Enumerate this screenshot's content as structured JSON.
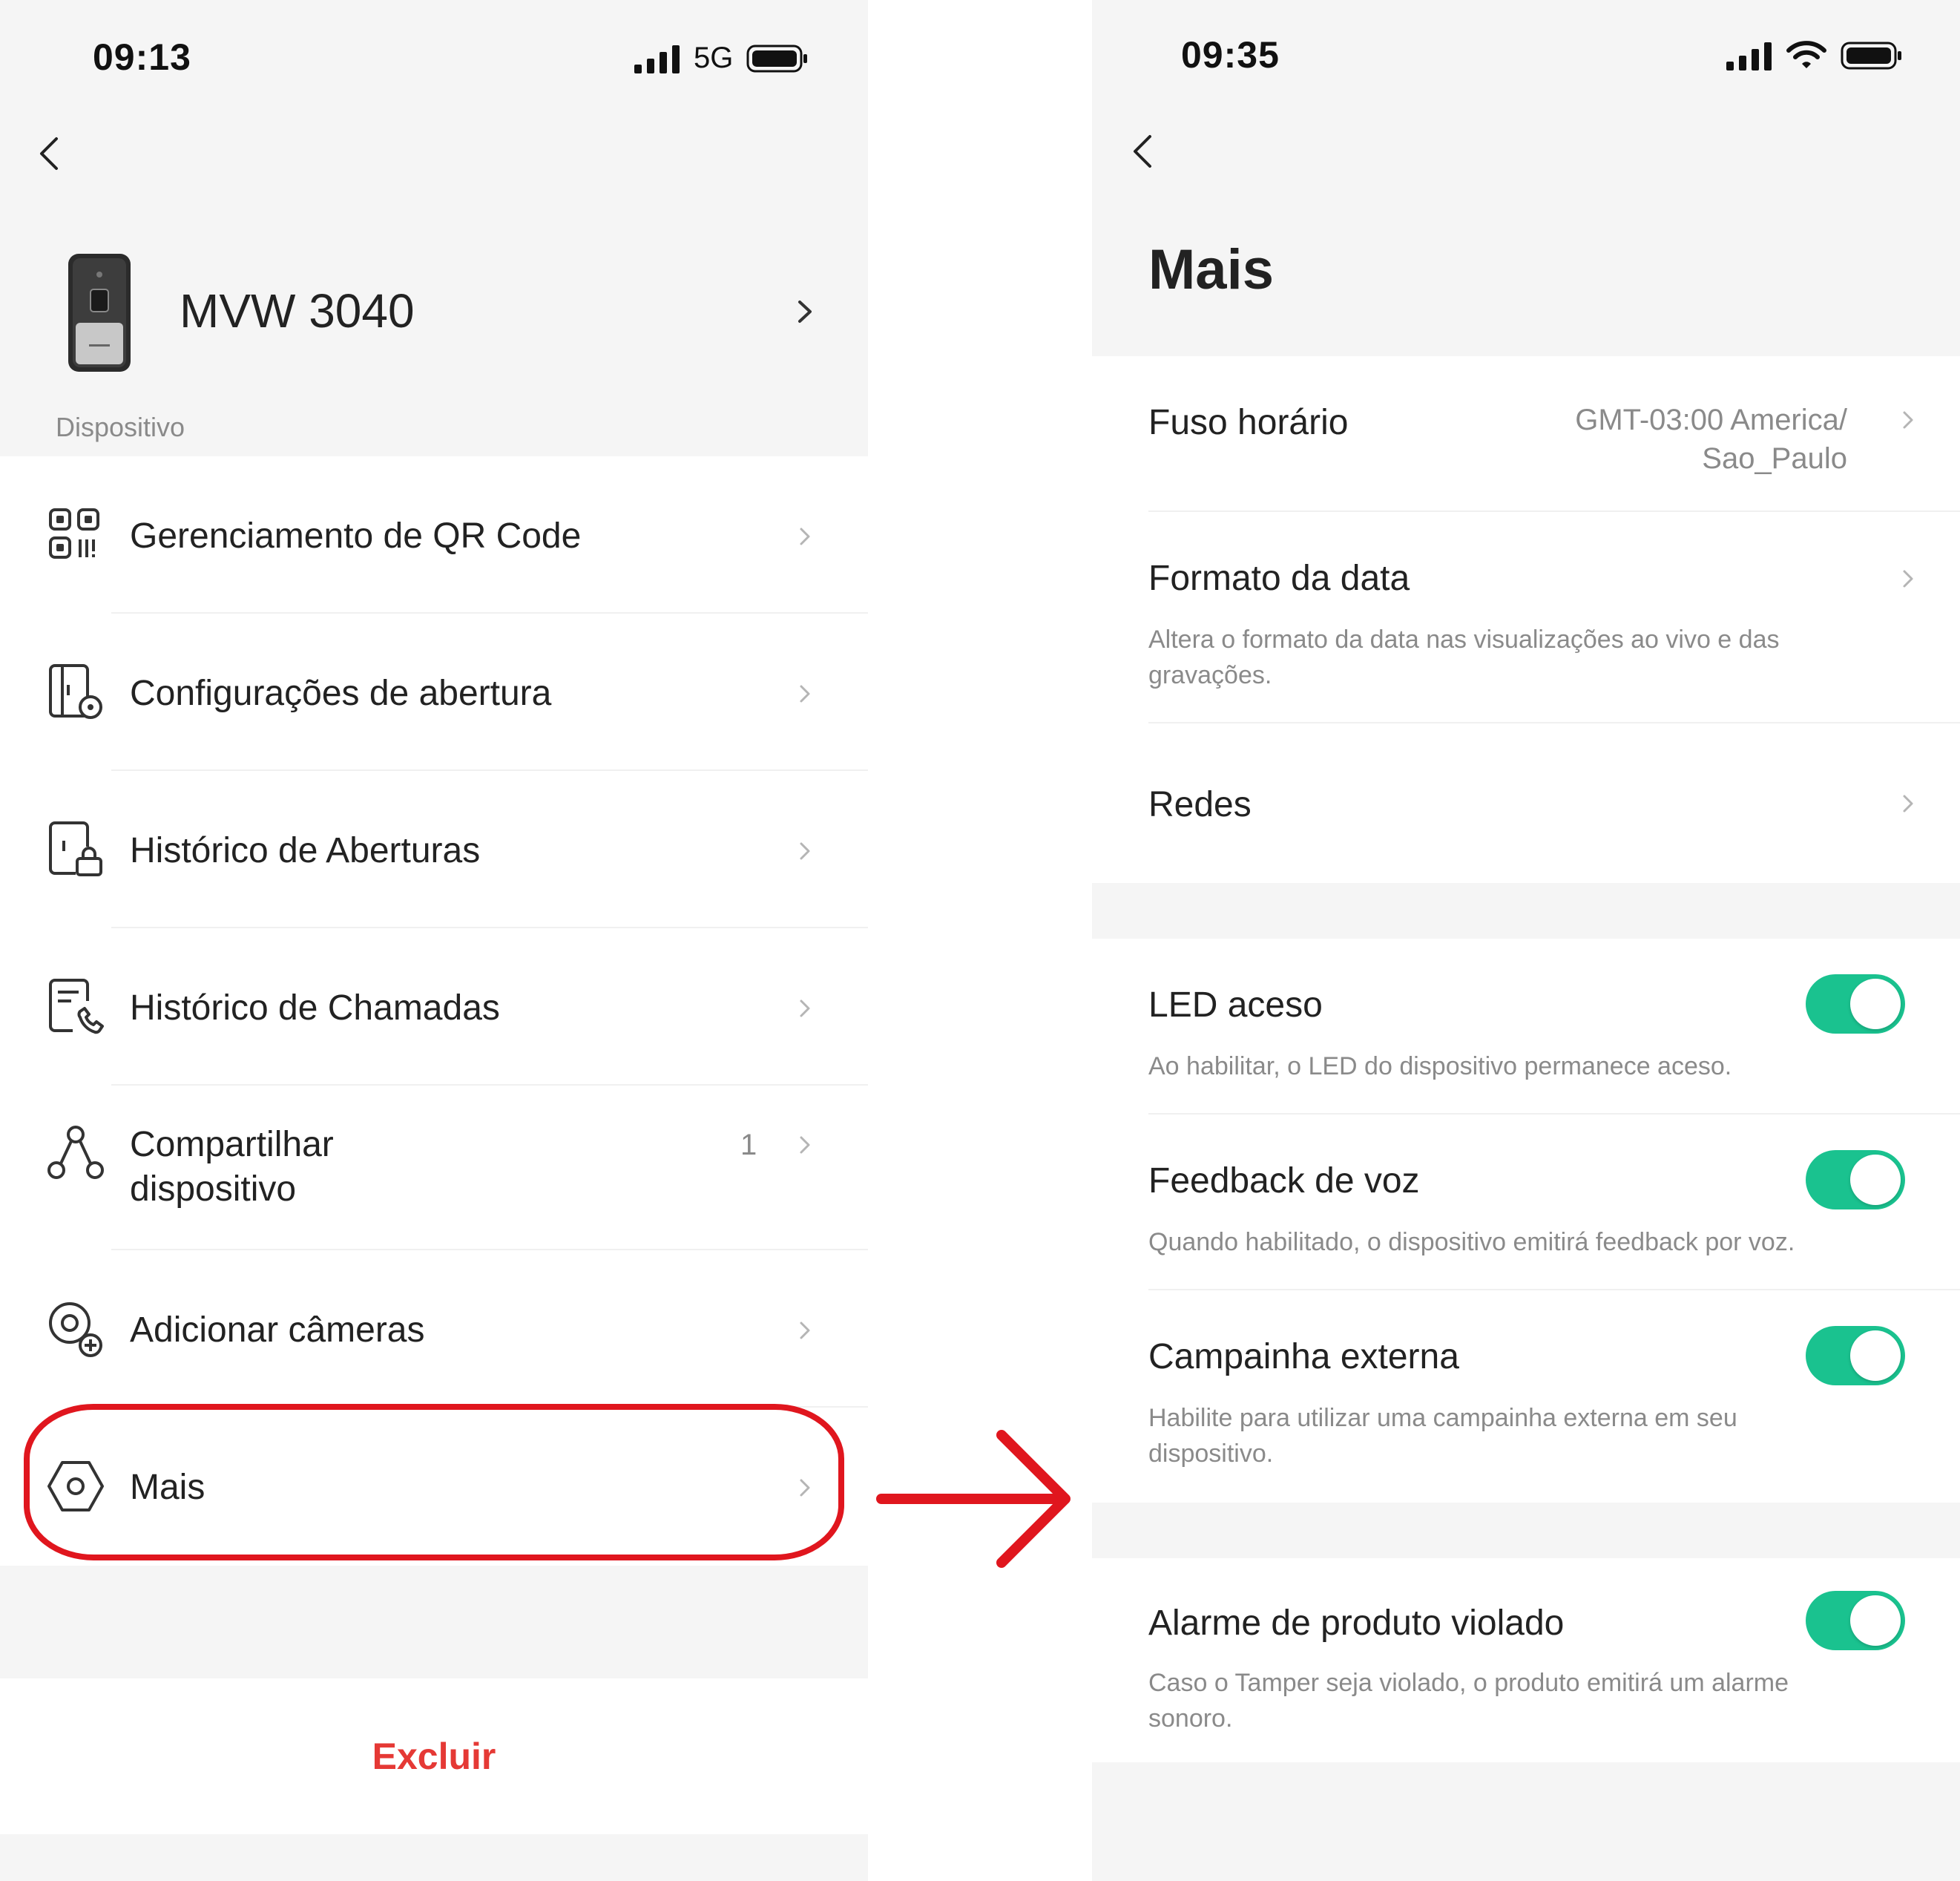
{
  "left_screen": {
    "status_bar": {
      "time": "09:13",
      "network": "5G"
    },
    "device": {
      "name": "MVW 3040"
    },
    "section_caption": "Dispositivo",
    "menu": [
      {
        "label": "Gerenciamento de QR Code",
        "icon": "qr-code-icon"
      },
      {
        "label": "Configurações de abertura",
        "icon": "door-settings-icon"
      },
      {
        "label": "Histórico de Aberturas",
        "icon": "door-lock-history-icon"
      },
      {
        "label": "Histórico de Chamadas",
        "icon": "call-history-icon"
      },
      {
        "label_line1": "Compartilhar",
        "label_line2": "dispositivo",
        "badge": "1",
        "icon": "share-device-icon"
      },
      {
        "label": "Adicionar câmeras",
        "icon": "add-camera-icon"
      },
      {
        "label": "Mais",
        "icon": "hexagon-settings-icon"
      }
    ],
    "delete_label": "Excluir"
  },
  "right_screen": {
    "status_bar": {
      "time": "09:35"
    },
    "title": "Mais",
    "group1": [
      {
        "title": "Fuso horário",
        "value_line1": "GMT-03:00 America/",
        "value_line2": "Sao_Paulo"
      },
      {
        "title": "Formato da data",
        "desc": "Altera o formato da data nas visualizações ao vivo e das gravações."
      },
      {
        "title": "Redes"
      }
    ],
    "toggles": [
      {
        "title": "LED aceso",
        "desc": "Ao habilitar, o LED do dispositivo permanece aceso.",
        "on": true
      },
      {
        "title": "Feedback de voz",
        "desc": "Quando habilitado, o dispositivo emitirá feedback por voz.",
        "on": true
      },
      {
        "title": "Campainha externa",
        "desc": "Habilite para utilizar uma campainha externa em seu dispositivo.",
        "on": true
      }
    ],
    "group3": [
      {
        "title": "Alarme de produto violado",
        "desc": "Caso o Tamper seja violado, o produto emitirá um alarme sonoro.",
        "on": true
      }
    ]
  },
  "colors": {
    "toggle_on": "#1ac28f",
    "highlight_red": "#e0161e",
    "delete_red": "#e53935",
    "background_gray": "#f5f5f5"
  }
}
